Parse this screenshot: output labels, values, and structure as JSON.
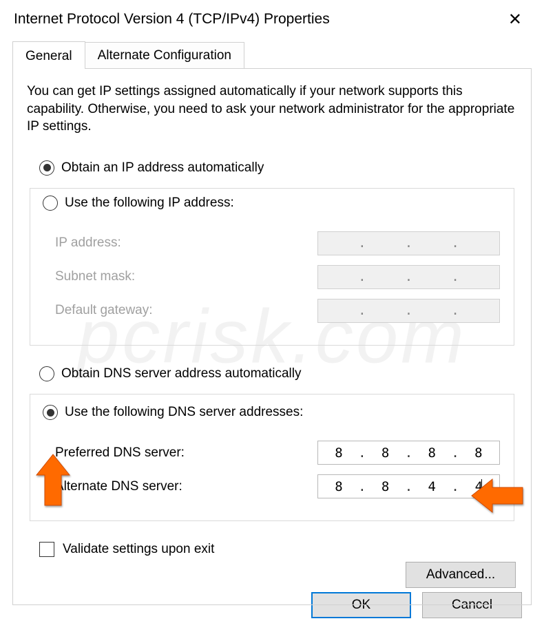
{
  "window": {
    "title": "Internet Protocol Version 4 (TCP/IPv4) Properties"
  },
  "tabs": {
    "general": "General",
    "alternate": "Alternate Configuration"
  },
  "intro": "You can get IP settings assigned automatically if your network supports this capability. Otherwise, you need to ask your network administrator for the appropriate IP settings.",
  "ip_section": {
    "obtain_auto": "Obtain an IP address automatically",
    "use_following": "Use the following IP address:",
    "ip_address_label": "IP address:",
    "subnet_label": "Subnet mask:",
    "gateway_label": "Default gateway:"
  },
  "dns_section": {
    "obtain_auto": "Obtain DNS server address automatically",
    "use_following": "Use the following DNS server addresses:",
    "preferred_label": "Preferred DNS server:",
    "alternate_label": "Alternate DNS server:",
    "preferred_value": {
      "o1": "8",
      "o2": "8",
      "o3": "8",
      "o4": "8"
    },
    "alternate_value": {
      "o1": "8",
      "o2": "8",
      "o3": "4",
      "o4": "4"
    }
  },
  "validate_label": "Validate settings upon exit",
  "advanced_label": "Advanced...",
  "buttons": {
    "ok": "OK",
    "cancel": "Cancel"
  },
  "watermark": "pcrisk.com"
}
